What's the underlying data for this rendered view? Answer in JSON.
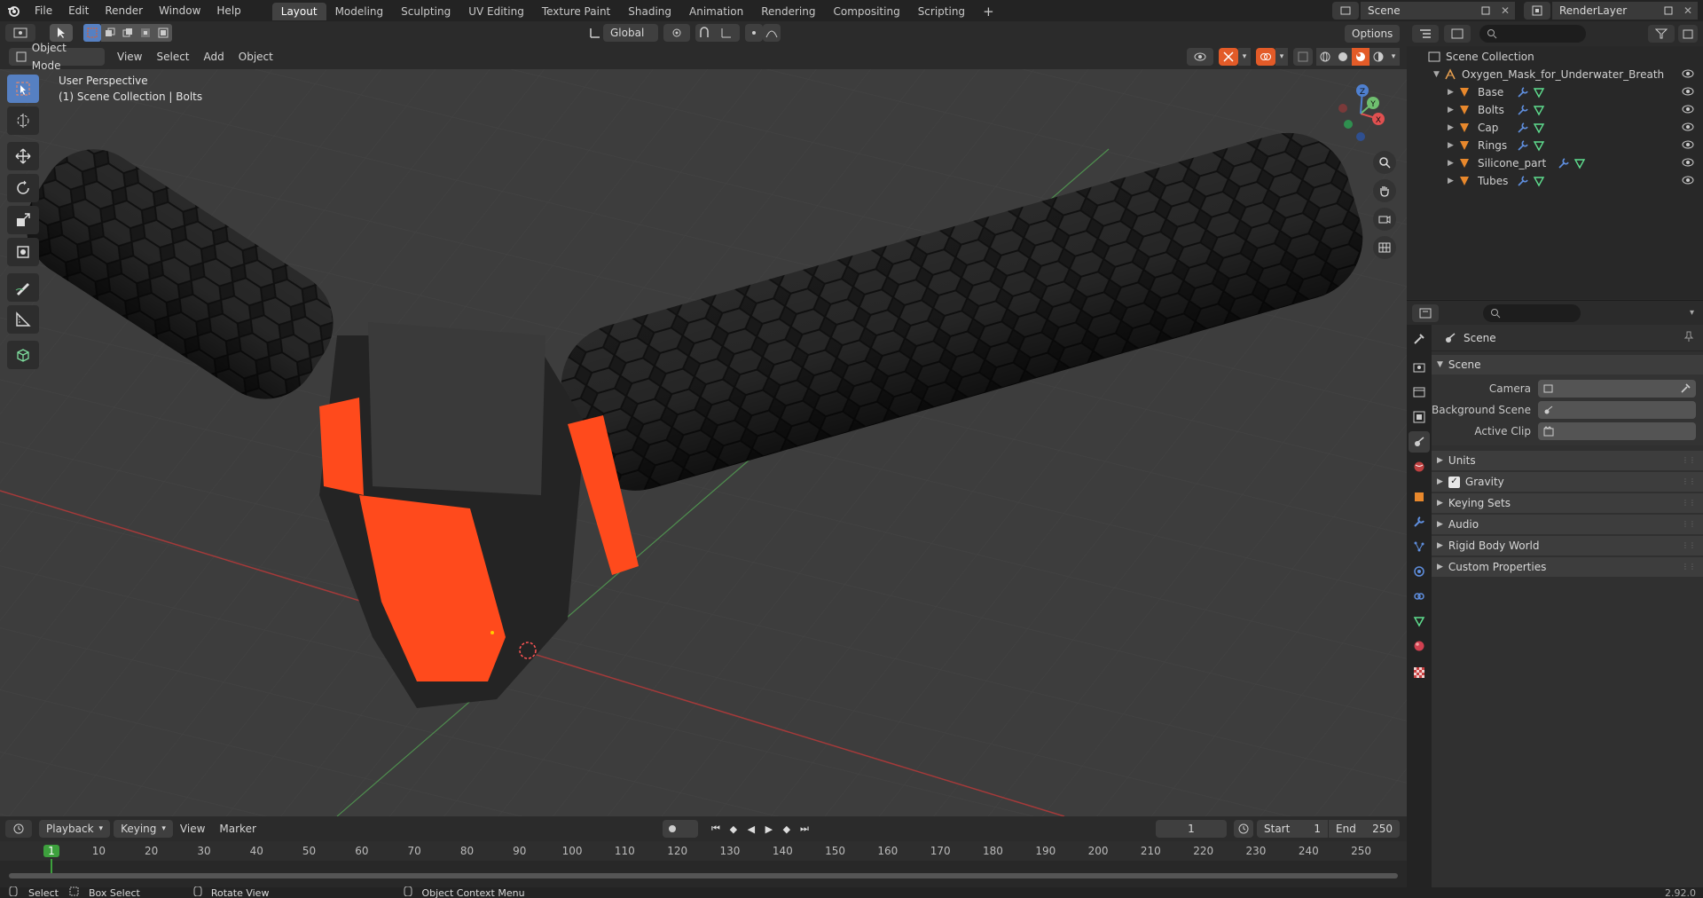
{
  "topbar": {
    "menus": [
      "File",
      "Edit",
      "Render",
      "Window",
      "Help"
    ],
    "workspaces": [
      "Layout",
      "Modeling",
      "Sculpting",
      "UV Editing",
      "Texture Paint",
      "Shading",
      "Animation",
      "Rendering",
      "Compositing",
      "Scripting"
    ],
    "active_workspace": "Layout",
    "scene_name": "Scene",
    "view_layer": "RenderLayer"
  },
  "viewport_header": {
    "mode": "Object Mode",
    "menus": [
      "View",
      "Select",
      "Add",
      "Object"
    ],
    "transform_orientation": "Global",
    "options_label": "Options"
  },
  "viewport": {
    "perspective_label": "User Perspective",
    "collection_label": "(1) Scene Collection | Bolts",
    "gizmo_axes": [
      "X",
      "Y",
      "Z"
    ]
  },
  "outliner": {
    "root": "Scene Collection",
    "collection": "Oxygen_Mask_for_Underwater_Breathing_Re",
    "items": [
      "Base",
      "Bolts",
      "Cap",
      "Rings",
      "Silicone_part",
      "Tubes"
    ]
  },
  "properties": {
    "context_title": "Scene",
    "panel_title": "Scene",
    "fields": [
      {
        "label": "Camera"
      },
      {
        "label": "Background Scene"
      },
      {
        "label": "Active Clip"
      }
    ],
    "subpanels": [
      "Units",
      "Gravity",
      "Keying Sets",
      "Audio",
      "Rigid Body World",
      "Custom Properties"
    ],
    "gravity_checked": true
  },
  "timeline_header": {
    "menus": [
      "Playback",
      "Keying",
      "View",
      "Marker"
    ],
    "current_frame": "1",
    "start_label": "Start",
    "start_value": "1",
    "end_label": "End",
    "end_value": "250"
  },
  "timeline": {
    "ticks": [
      "1",
      "10",
      "20",
      "30",
      "40",
      "50",
      "60",
      "70",
      "80",
      "90",
      "100",
      "110",
      "120",
      "130",
      "140",
      "150",
      "160",
      "170",
      "180",
      "190",
      "200",
      "210",
      "220",
      "230",
      "240",
      "250"
    ],
    "current": "1"
  },
  "statusbar": {
    "items": [
      "Select",
      "Box Select",
      "Rotate View",
      "Object Context Menu"
    ],
    "version": "2.92.0"
  },
  "colors": {
    "accent_orange": "#e35b28",
    "selection_blue": "#5680c2",
    "mask_orange": "#ff4a1c"
  }
}
